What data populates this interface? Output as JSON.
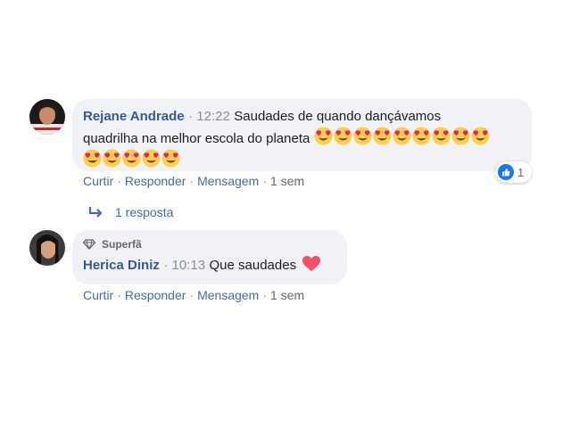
{
  "comment1": {
    "author": "Rejane Andrade",
    "time": "12:22",
    "text_line1": "Saudades de quando dançávamos",
    "text_line2": "quadrilha na melhor escola do planeta",
    "emoji_line2_count": 9,
    "emoji_line3_count": 5,
    "emoji": "heart-eyes-emoji",
    "reaction_count": "1",
    "actions": {
      "like": "Curtir",
      "reply": "Responder",
      "message": "Mensagem",
      "age": "1 sem"
    }
  },
  "replies_link": {
    "label": "1 resposta"
  },
  "comment2": {
    "badge": "Superfã",
    "author": "Herica Diniz",
    "time": "10:13",
    "text": "Que saudades",
    "emoji": "heart-emoji",
    "actions": {
      "like": "Curtir",
      "reply": "Responder",
      "message": "Mensagem",
      "age": "1 sem"
    }
  },
  "colors": {
    "author": "#385898",
    "bubble": "#f0f2f5",
    "like_blue": "#1877f2",
    "heart": "#f25268"
  }
}
